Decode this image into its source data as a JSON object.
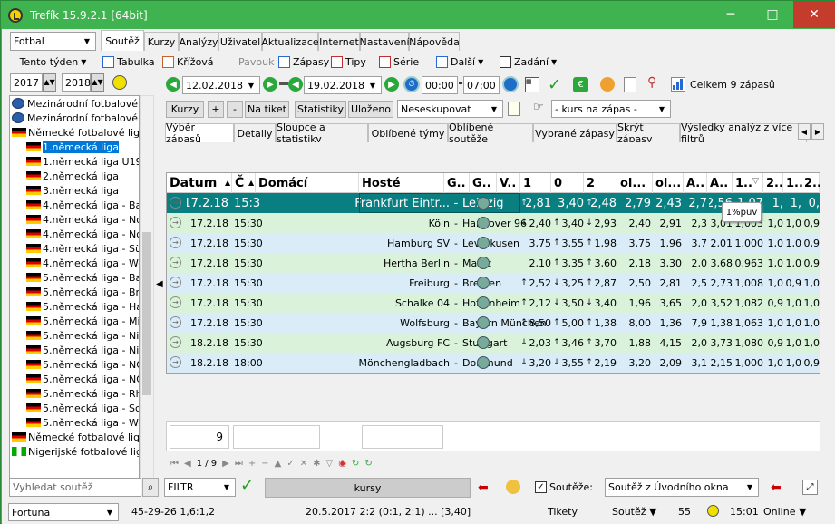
{
  "title": "Trefík 15.9.2.1 [64bit]",
  "window_buttons": [
    "─",
    "□",
    "✕"
  ],
  "left": {
    "sport": "Fotbal",
    "period": "Tento týden",
    "year_from": "2017",
    "year_to": "2018",
    "search_placeholder": "Vyhledat soutěž",
    "tree": [
      {
        "icon": "globe",
        "label": "Mezinárodní fotbalové t"
      },
      {
        "icon": "globe",
        "label": "Mezinárodní fotbalové t"
      },
      {
        "icon": "flag",
        "label": "Německé fotbalové ligy"
      },
      {
        "icon": "flag",
        "label": "1.německá liga",
        "selected": true
      },
      {
        "icon": "flag",
        "label": "1.německá liga U19"
      },
      {
        "icon": "flag",
        "label": "2.německá liga"
      },
      {
        "icon": "flag",
        "label": "3.německá liga"
      },
      {
        "icon": "flag",
        "label": "4.německá liga - Bayer"
      },
      {
        "icon": "flag",
        "label": "4.německá liga - Nord"
      },
      {
        "icon": "flag",
        "label": "4.německá liga - Nordo"
      },
      {
        "icon": "flag",
        "label": "4.německá liga - Südw"
      },
      {
        "icon": "flag",
        "label": "4.německá liga - West"
      },
      {
        "icon": "flag",
        "label": "5.německá liga - Bader"
      },
      {
        "icon": "flag",
        "label": "5.německá liga - Breme"
      },
      {
        "icon": "flag",
        "label": "5.německá liga - Hamb"
      },
      {
        "icon": "flag",
        "label": "5.německá liga - Mittel"
      },
      {
        "icon": "flag",
        "label": "5.německá liga - Niede"
      },
      {
        "icon": "flag",
        "label": "5.německá liga - Niede"
      },
      {
        "icon": "flag",
        "label": "5.německá liga - NOFV"
      },
      {
        "icon": "flag",
        "label": "5.německá liga - NOFV"
      },
      {
        "icon": "flag",
        "label": "5.německá liga - Rheir"
      },
      {
        "icon": "flag",
        "label": "5.německá liga - Schle"
      },
      {
        "icon": "flag",
        "label": "5.německá liga - West"
      },
      {
        "icon": "flag",
        "label": "Německé fotbalové ligy"
      },
      {
        "icon": "ng",
        "label": "Nigerijské fotbalové ligy"
      }
    ]
  },
  "menu_tabs": [
    "Soutěž",
    "Kurzy",
    "Analýzy",
    "Uživatel",
    "Aktualizace",
    "Internet",
    "Nastavení",
    "Nápověda"
  ],
  "toolbar1": [
    "Tabulka",
    "Křížová",
    "Pavouk",
    "Zápasy",
    "Tipy",
    "Série",
    "Další",
    "Zadání"
  ],
  "dates": {
    "from": "12.02.2018",
    "to": "19.02.2018",
    "time_from": "00:00",
    "time_to": "07:00",
    "total": "Celkem 9 zápasů"
  },
  "toolbar2": {
    "kurzy": "Kurzy",
    "plus": "+",
    "minus": "-",
    "na_tiket": "Na tiket",
    "statistiky": "Statistiky",
    "ulozeno": "Uloženo",
    "neseskupovat": "Neseskupovat",
    "kurs": "- kurs na zápas -"
  },
  "view_tabs": [
    "Výběr zápasů",
    "Detaily",
    "Sloupce a statistiky",
    "Oblíbené týmy",
    "Oblíbené soutěže",
    "Vybrané zápasy",
    "Skrýt zápasy",
    "Výsledky analýz z více filtrů"
  ],
  "columns": [
    "Datum",
    "Č",
    "Domácí",
    "Hosté",
    "G..",
    "G..",
    "V..",
    "1",
    "0",
    "2",
    "ol...",
    "ol...",
    "A..",
    "A..",
    "1..",
    "2..",
    "1..",
    "2.."
  ],
  "tooltip": "1%puv",
  "rows": [
    {
      "date": "17.2.18",
      "time": "15:3",
      "home": "Frankfurt Eintr...",
      "away": "Leipzig",
      "a1": "↑",
      "o1": "2,81",
      "a2": "",
      "o0": "3,40",
      "a3": "↑",
      "o2": "2,48",
      "ol1": "2,79",
      "ol2": "2,43",
      "A1": "2,7",
      "A2": "2,56",
      "c1": "1,07",
      "c2": "1,",
      "c3": "1,",
      "c4": "0,",
      "selected": true
    },
    {
      "date": "17.2.18",
      "time": "15:30",
      "home": "Köln",
      "away": "Hannover 96",
      "a1": "↓",
      "o1": "2,40",
      "a2": "↑",
      "o0": "3,40",
      "a3": "↓",
      "o2": "2,93",
      "ol1": "2,40",
      "ol2": "2,91",
      "A1": "2,3",
      "A2": "3,01",
      "c1": "1,003",
      "c2": "1,0",
      "c3": "1,0",
      "c4": "0,9"
    },
    {
      "date": "17.2.18",
      "time": "15:30",
      "home": "Hamburg SV",
      "away": "Leverkusen",
      "a1": "",
      "o1": "3,75",
      "a2": "↑",
      "o0": "3,55",
      "a3": "↑",
      "o2": "1,98",
      "ol1": "3,75",
      "ol2": "1,96",
      "A1": "3,7",
      "A2": "2,01",
      "c1": "1,000",
      "c2": "1,0",
      "c3": "1,0",
      "c4": "0,9"
    },
    {
      "date": "17.2.18",
      "time": "15:30",
      "home": "Hertha Berlin",
      "away": "Mainz",
      "a1": "",
      "o1": "2,10",
      "a2": "↑",
      "o0": "3,35",
      "a3": "↑",
      "o2": "3,60",
      "ol1": "2,18",
      "ol2": "3,30",
      "A1": "2,0",
      "A2": "3,68",
      "c1": "0,963",
      "c2": "1,0",
      "c3": "1,0",
      "c4": "0,9"
    },
    {
      "date": "17.2.18",
      "time": "15:30",
      "home": "Freiburg",
      "away": "Bremen",
      "a1": "↑",
      "o1": "2,52",
      "a2": "↓",
      "o0": "3,25",
      "a3": "↑",
      "o2": "2,87",
      "ol1": "2,50",
      "ol2": "2,81",
      "A1": "2,5",
      "A2": "2,73",
      "c1": "1,008",
      "c2": "1,0",
      "c3": "0,9",
      "c4": "1,0"
    },
    {
      "date": "17.2.18",
      "time": "15:30",
      "home": "Schalke 04",
      "away": "Hoffenheim",
      "a1": "↑",
      "o1": "2,12",
      "a2": "↓",
      "o0": "3,50",
      "a3": "↓",
      "o2": "3,40",
      "ol1": "1,96",
      "ol2": "3,65",
      "A1": "2,0",
      "A2": "3,52",
      "c1": "1,082",
      "c2": "0,9",
      "c3": "1,0",
      "c4": "1,0"
    },
    {
      "date": "17.2.18",
      "time": "15:30",
      "home": "Wolfsburg",
      "away": "Bayern München",
      "a1": "↑",
      "o1": "8,50",
      "a2": "↑",
      "o0": "5,00",
      "a3": "↑",
      "o2": "1,38",
      "ol1": "8,00",
      "ol2": "1,36",
      "A1": "7,9",
      "A2": "1,38",
      "c1": "1,063",
      "c2": "1,0",
      "c3": "1,0",
      "c4": "1,0"
    },
    {
      "date": "18.2.18",
      "time": "15:30",
      "home": "Augsburg FC",
      "away": "Stuttgart",
      "a1": "↓",
      "o1": "2,03",
      "a2": "↑",
      "o0": "3,46",
      "a3": "↑",
      "o2": "3,70",
      "ol1": "1,88",
      "ol2": "4,15",
      "A1": "2,0",
      "A2": "3,73",
      "c1": "1,080",
      "c2": "0,9",
      "c3": "1,0",
      "c4": "1,0"
    },
    {
      "date": "18.2.18",
      "time": "18:00",
      "home": "Mönchengladbach",
      "away": "Dortmund",
      "a1": "↓",
      "o1": "3,20",
      "a2": "↓",
      "o0": "3,55",
      "a3": "↑",
      "o2": "2,19",
      "ol1": "3,20",
      "ol2": "2,09",
      "A1": "3,1",
      "A2": "2,15",
      "c1": "1,000",
      "c2": "1,0",
      "c3": "1,0",
      "c4": "0,9"
    }
  ],
  "summary_count": "9",
  "pager": "1 / 9",
  "filter": {
    "label": "FILTR",
    "kursy": "kursy",
    "souteze_label": "Soutěže:",
    "souteze_value": "Soutěž z Úvodního okna"
  },
  "status": {
    "bookmaker": "Fortuna",
    "stats": "45-29-26  1,6:1,2",
    "last": "20.5.2017 2:2 (0:1, 2:1) ... [3,40]",
    "tikety": "Tikety",
    "soutez": "Soutěž ▼",
    "count": "55",
    "time": "15:01",
    "online": "Online ▼"
  }
}
